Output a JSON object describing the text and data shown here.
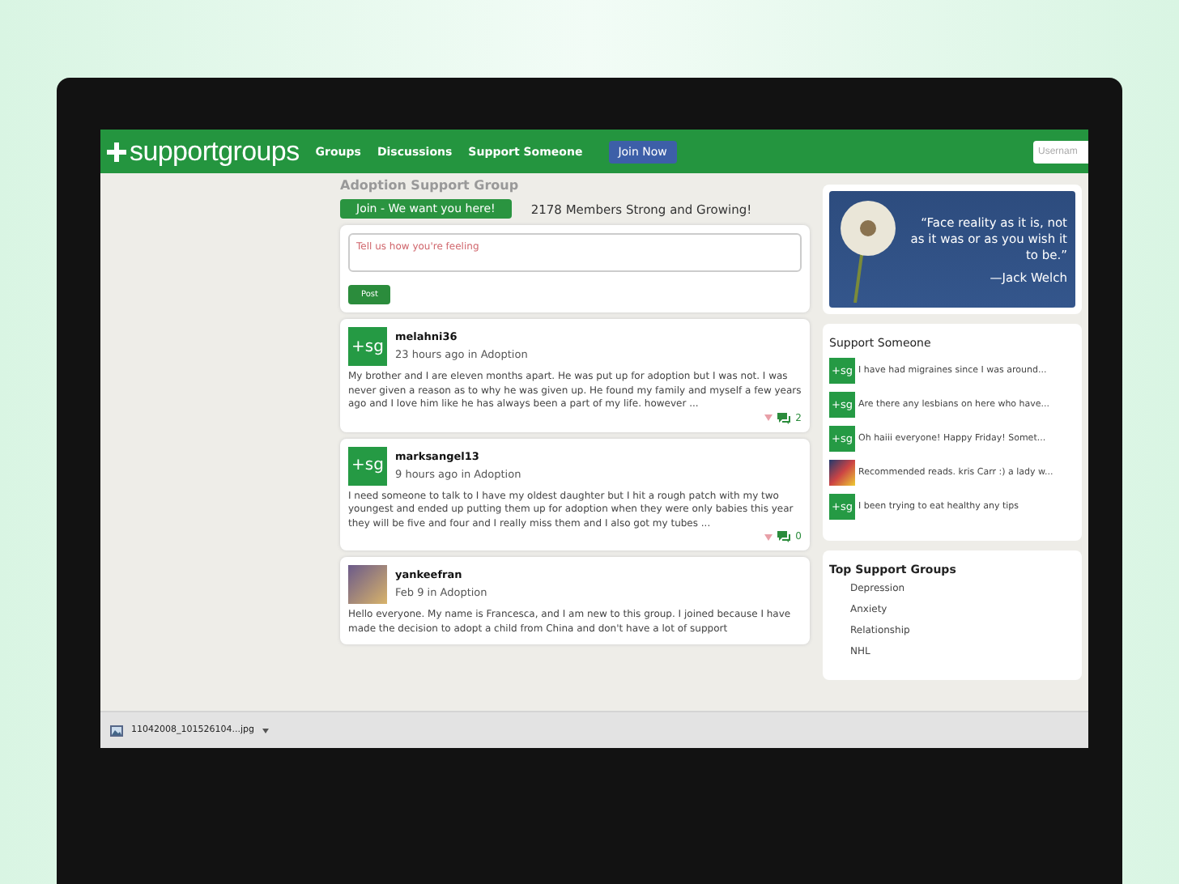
{
  "nav": {
    "logo": "**support**groups",
    "links": [
      "Groups",
      "Discussions",
      "Support Someone"
    ],
    "join": "Join Now",
    "username_placeholder": "Usernam"
  },
  "group": {
    "title": "Adoption Support Group",
    "join_button": "Join - We want you here!",
    "members": "2178 Members Strong and Growing!"
  },
  "composer": {
    "placeholder": "Tell us how you're feeling",
    "button": "Post"
  },
  "posts": [
    {
      "author": "melahni36",
      "meta": "23 hours ago in Adoption",
      "avatar": {
        "kind": "sg",
        "text": "+sg"
      },
      "body": "My brother and I are eleven months apart. He was put up for adoption but I was not. I was never given a reason as to why he was given up. He found my family and myself a few years ago and I love him like he has always been a part of my life. however ...",
      "comments": "2"
    },
    {
      "author": "marksangel13",
      "meta": "9 hours ago in Adoption",
      "avatar": {
        "kind": "sg",
        "text": "+sg"
      },
      "body": "I need someone to talk to I have my oldest daughter but I hit a rough patch with my two youngest and ended up putting them up for adoption when they were only babies this year they will be five and four and I really miss them and I also got my tubes ...",
      "comments": "0"
    },
    {
      "author": "yankeefran",
      "meta": "Feb 9 in Adoption",
      "avatar": {
        "kind": "photo"
      },
      "body": "Hello everyone. My name is Francesca, and I am new to this group. I joined because I have made the decision to adopt a child from China and don't have a lot of support"
    }
  ],
  "quote": {
    "text": "“Face reality as it is, not as it was or as you wish it to be.”",
    "author": "—Jack Welch"
  },
  "support_someone": {
    "title": "Support Someone",
    "items": [
      {
        "avatar": {
          "kind": "sg",
          "text": "+sg"
        },
        "text": "I have had migraines since I was around..."
      },
      {
        "avatar": {
          "kind": "sg",
          "text": "+sg"
        },
        "text": "Are there any lesbians on here who have..."
      },
      {
        "avatar": {
          "kind": "sg",
          "text": "+sg"
        },
        "text": "Oh haiii everyone! Happy Friday! Somet..."
      },
      {
        "avatar": {
          "kind": "photo"
        },
        "text": "Recommended reads. kris Carr :) a lady w..."
      },
      {
        "avatar": {
          "kind": "sg",
          "text": "+sg"
        },
        "text": "I been trying to eat healthy any tips"
      }
    ]
  },
  "top_groups": {
    "title": "Top Support Groups",
    "items": [
      "Depression",
      "Anxiety",
      "Relationship",
      "NHL"
    ]
  },
  "download_bar": {
    "file": "11042008_101526104...jpg"
  }
}
